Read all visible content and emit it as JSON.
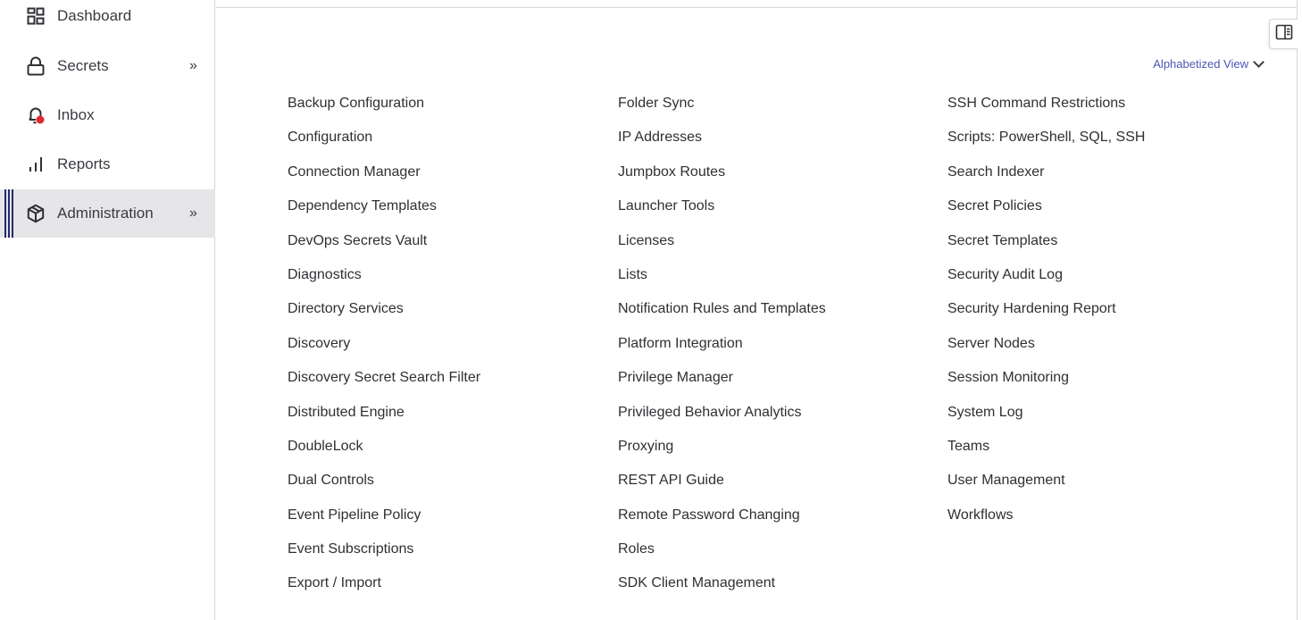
{
  "sidebar": {
    "items": [
      {
        "label": "Dashboard",
        "icon": "dashboard-icon"
      },
      {
        "label": "Secrets",
        "icon": "lock-icon",
        "chevron": "»"
      },
      {
        "label": "Inbox",
        "icon": "bell-icon"
      },
      {
        "label": "Reports",
        "icon": "bar-chart-icon"
      },
      {
        "label": "Administration",
        "icon": "cube-icon",
        "chevron": "»",
        "active": true
      }
    ]
  },
  "main": {
    "view_select_label": "Alphabetized View",
    "columns": [
      [
        "Backup Configuration",
        "Configuration",
        "Connection Manager",
        "Dependency Templates",
        "DevOps Secrets Vault",
        "Diagnostics",
        "Directory Services",
        "Discovery",
        "Discovery Secret Search Filter",
        "Distributed Engine",
        "DoubleLock",
        "Dual Controls",
        "Event Pipeline Policy",
        "Event Subscriptions",
        "Export / Import"
      ],
      [
        "Folder Sync",
        "IP Addresses",
        "Jumpbox Routes",
        "Launcher Tools",
        "Licenses",
        "Lists",
        "Notification Rules and Templates",
        "Platform Integration",
        "Privilege Manager",
        "Privileged Behavior Analytics",
        "Proxying",
        "REST API Guide",
        "Remote Password Changing",
        "Roles",
        "SDK Client Management"
      ],
      [
        "SSH Command Restrictions",
        "Scripts: PowerShell, SQL, SSH",
        "Search Indexer",
        "Secret Policies",
        "Secret Templates",
        "Security Audit Log",
        "Security Hardening Report",
        "Server Nodes",
        "Session Monitoring",
        "System Log",
        "Teams",
        "User Management",
        "Workflows"
      ]
    ]
  },
  "colors": {
    "active_bar": "#232a6e",
    "active_bg": "#e6e6e9",
    "notification_dot": "#e0292e",
    "view_select_text": "#4b57b8"
  }
}
